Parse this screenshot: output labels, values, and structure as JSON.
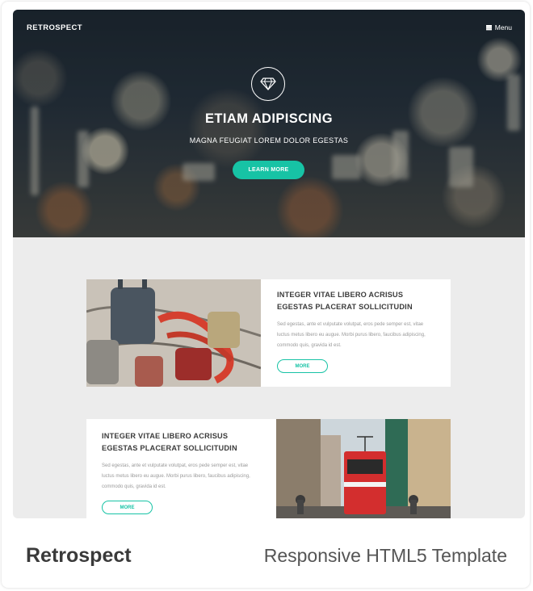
{
  "site": {
    "brand": "RETROSPECT",
    "menu_label": "Menu",
    "menu_icon": "hamburger-icon"
  },
  "hero": {
    "icon": "diamond-icon",
    "title": "ETIAM ADIPISCING",
    "subtitle": "MAGNA FEUGIAT LOREM DOLOR EGESTAS",
    "button_label": "LEARN MORE"
  },
  "features": [
    {
      "title": "INTEGER VITAE LIBERO ACRISUS EGESTAS PLACERAT SOLLICITUDIN",
      "body": "Sed egestas, ante et vulputate volutpat, eros pede semper est, vitae luctus metus libero eu augue. Morbi purus libero, faucibus adipiscing, commodo quis, gravida id est.",
      "button_label": "MORE",
      "image": "padlocks-photo"
    },
    {
      "title": "INTEGER VITAE LIBERO ACRISUS EGESTAS PLACERAT SOLLICITUDIN",
      "body": "Sed egestas, ante et vulputate volutpat, eros pede semper est, vitae luctus metus libero eu augue. Morbi purus libero, faucibus adipiscing, commodo quis, gravida id est.",
      "button_label": "MORE",
      "image": "red-tram-photo"
    }
  ],
  "caption": {
    "name": "Retrospect",
    "description": "Responsive HTML5 Template"
  },
  "colors": {
    "accent": "#17c3a5",
    "hero_dark": "#1b242c",
    "section_bg": "#ececec"
  }
}
